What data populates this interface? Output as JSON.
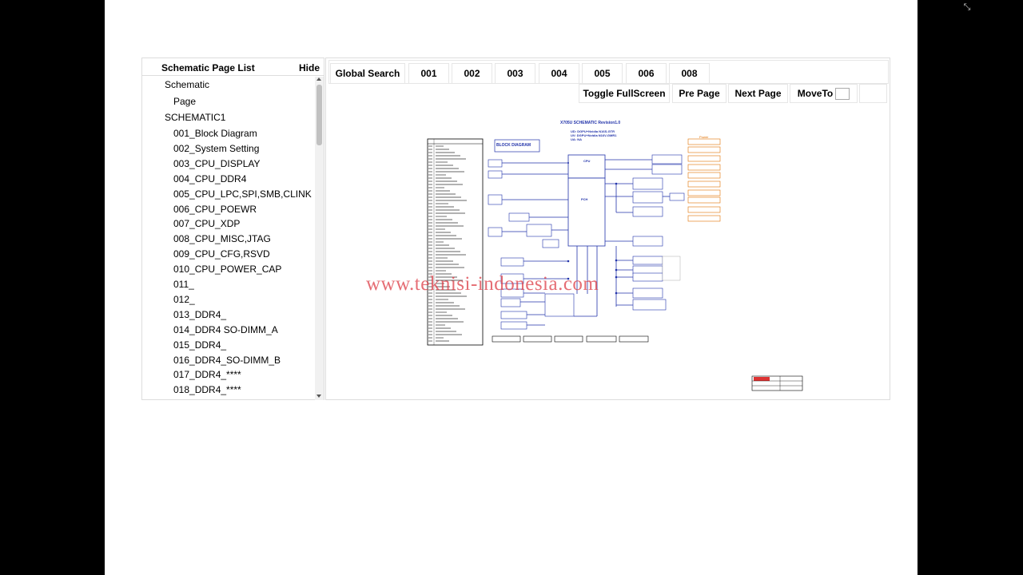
{
  "window": {
    "exit_fullscreen_icon": "exit-fullscreen-icon"
  },
  "page_list": {
    "title": "Schematic Page List",
    "hide_label": "Hide",
    "items": [
      {
        "label": "Schematic",
        "level": 1
      },
      {
        "label": "Page",
        "level": 2
      },
      {
        "label": "SCHEMATIC1",
        "level": 1
      },
      {
        "label": "001_Block Diagram",
        "level": 2
      },
      {
        "label": "002_System Setting",
        "level": 2
      },
      {
        "label": "003_CPU_DISPLAY",
        "level": 2
      },
      {
        "label": "004_CPU_DDR4",
        "level": 2
      },
      {
        "label": "005_CPU_LPC,SPI,SMB,CLINK",
        "level": 2
      },
      {
        "label": "006_CPU_POEWR",
        "level": 2
      },
      {
        "label": "007_CPU_XDP",
        "level": 2
      },
      {
        "label": "008_CPU_MISC,JTAG",
        "level": 2
      },
      {
        "label": "009_CPU_CFG,RSVD",
        "level": 2
      },
      {
        "label": "010_CPU_POWER_CAP",
        "level": 2
      },
      {
        "label": "011_",
        "level": 2
      },
      {
        "label": "012_",
        "level": 2
      },
      {
        "label": "013_DDR4_",
        "level": 2
      },
      {
        "label": "014_DDR4 SO-DIMM_A",
        "level": 2
      },
      {
        "label": "015_DDR4_",
        "level": 2
      },
      {
        "label": "016_DDR4_SO-DIMM_B",
        "level": 2
      },
      {
        "label": "017_DDR4_****",
        "level": 2
      },
      {
        "label": "018_DDR4_****",
        "level": 2
      }
    ]
  },
  "toolbar": {
    "global_search": "Global Search",
    "pages": [
      "001",
      "002",
      "003",
      "004",
      "005",
      "006",
      "008"
    ],
    "toggle_fullscreen": "Toggle FullScreen",
    "pre_page": "Pre Page",
    "next_page": "Next Page",
    "move_to": "MoveTo"
  },
  "schematic": {
    "title": "X705U SCHEMATIC Revision1.0",
    "subtitle_lines": [
      "UD: DGPU+Nvidia N16S-GTR",
      "UV: DGPU+Nvidia N16V-GMR1",
      "UA: NA"
    ],
    "block_diagram_label": "BLOCK DIAGRAM",
    "cpu_label": "CPU",
    "pch_label": "PCH",
    "power_label": "Power",
    "watermark": "www.teknisi-indonesia.com",
    "colors": {
      "schematic_blue": "#2233aa",
      "power_orange": "#e07000",
      "watermark_red": "#dc3c46"
    }
  }
}
